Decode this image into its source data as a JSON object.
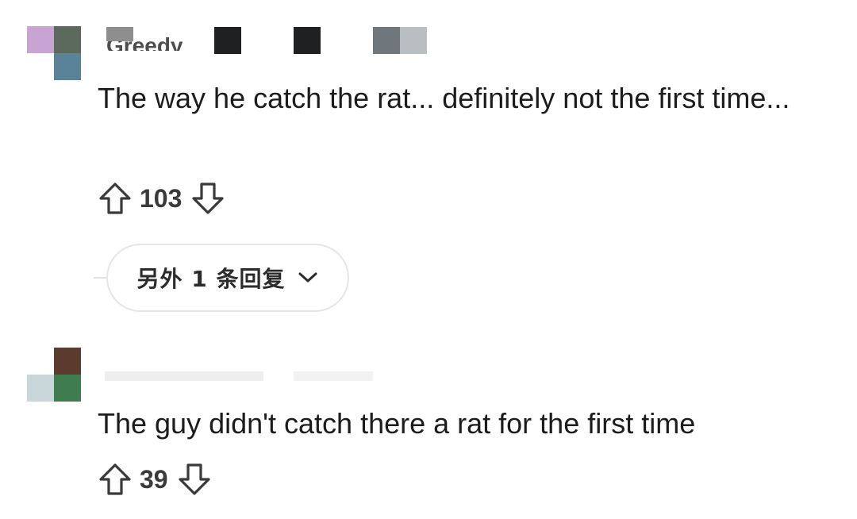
{
  "comments": [
    {
      "username": "Greedy_",
      "timestamp": "",
      "text": "The way he catch the rat... definitely not the first time...",
      "score": "103",
      "more_replies_label": "另外 1 条回复",
      "avatar_colors": [
        "#c7a4d1",
        "#5c6a5d",
        "#5b8397"
      ]
    },
    {
      "username": "",
      "timestamp": "",
      "text": "The guy didn't catch there a rat for the first time",
      "score": "39",
      "avatar_colors": [
        "#5a3b2e",
        "#c9d7db",
        "#3f7d4e"
      ]
    }
  ],
  "icons": {
    "upvote": "arrow-up-outline-icon",
    "downvote": "arrow-down-outline-icon",
    "expand": "chevron-down-icon"
  },
  "colors": {
    "text": "#1c1c1c",
    "muted": "#3a3a3a",
    "pill_border": "#e6e6e6"
  }
}
